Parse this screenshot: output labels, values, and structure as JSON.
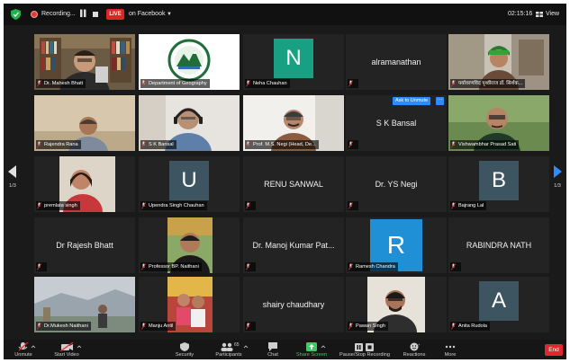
{
  "topbar": {
    "recording_label": "Recording...",
    "live_badge": "LIVE",
    "live_destination": "on Facebook",
    "timer": "02:15:16",
    "view_label": "View"
  },
  "pagination": {
    "left": "1/3",
    "right": "1/3"
  },
  "tiles": {
    "t1": "Dr. Mahesh Bhatt",
    "t2": "Department of Geography",
    "t3_initial": "N",
    "t3": "Neha Chauhan",
    "t4_center": "alramanathan",
    "t5": "पर्यावरणविद पृथ्वीराज डॉ. सिर्शक...",
    "t6": "Rajendra Rana",
    "t7": "S K Bansal",
    "t8": "Prof. M.S. Negi (Head, De...",
    "t9_center": "S K Bansal",
    "t9_ask": "Ask to Unmute",
    "t10": "Vishwambhar Prasad Sati",
    "t11": "premlata singh",
    "t12_initial": "U",
    "t12": "Upendra Singh Chauhan",
    "t13_center": "RENU SANWAL",
    "t14_center": "Dr. YS Negi",
    "t15_initial": "B",
    "t15": "Bajrang Lal",
    "t16_center": "Dr Rajesh Bhatt",
    "t17": "Professor BP. Naithani",
    "t18_center": "Dr. Manoj Kumar Pat...",
    "t19_initial": "R",
    "t19": "Ramesh Chandra",
    "t20_center": "RABINDRA NATH",
    "t21": "Dr.Mukesh Naithani",
    "t22": "Manju Antil",
    "t23_center": "shairy chaudhary",
    "t24": "Pawan Singh",
    "t25_initial": "A",
    "t25": "Anita Rudola"
  },
  "toolbar": {
    "unmute": "Unmute",
    "start_video": "Start Video",
    "security": "Security",
    "participants": "Participants",
    "participants_count": "65",
    "chat": "Chat",
    "share_screen": "Share Screen",
    "pause_recording": "Pause/Stop Recording",
    "reactions": "Reactions",
    "more": "More",
    "end": "End"
  },
  "colors": {
    "speaker_highlight": "#d9e84a",
    "share_green": "#43c664",
    "end_red": "#e0262e",
    "unmute_blue": "#2d8cff"
  }
}
